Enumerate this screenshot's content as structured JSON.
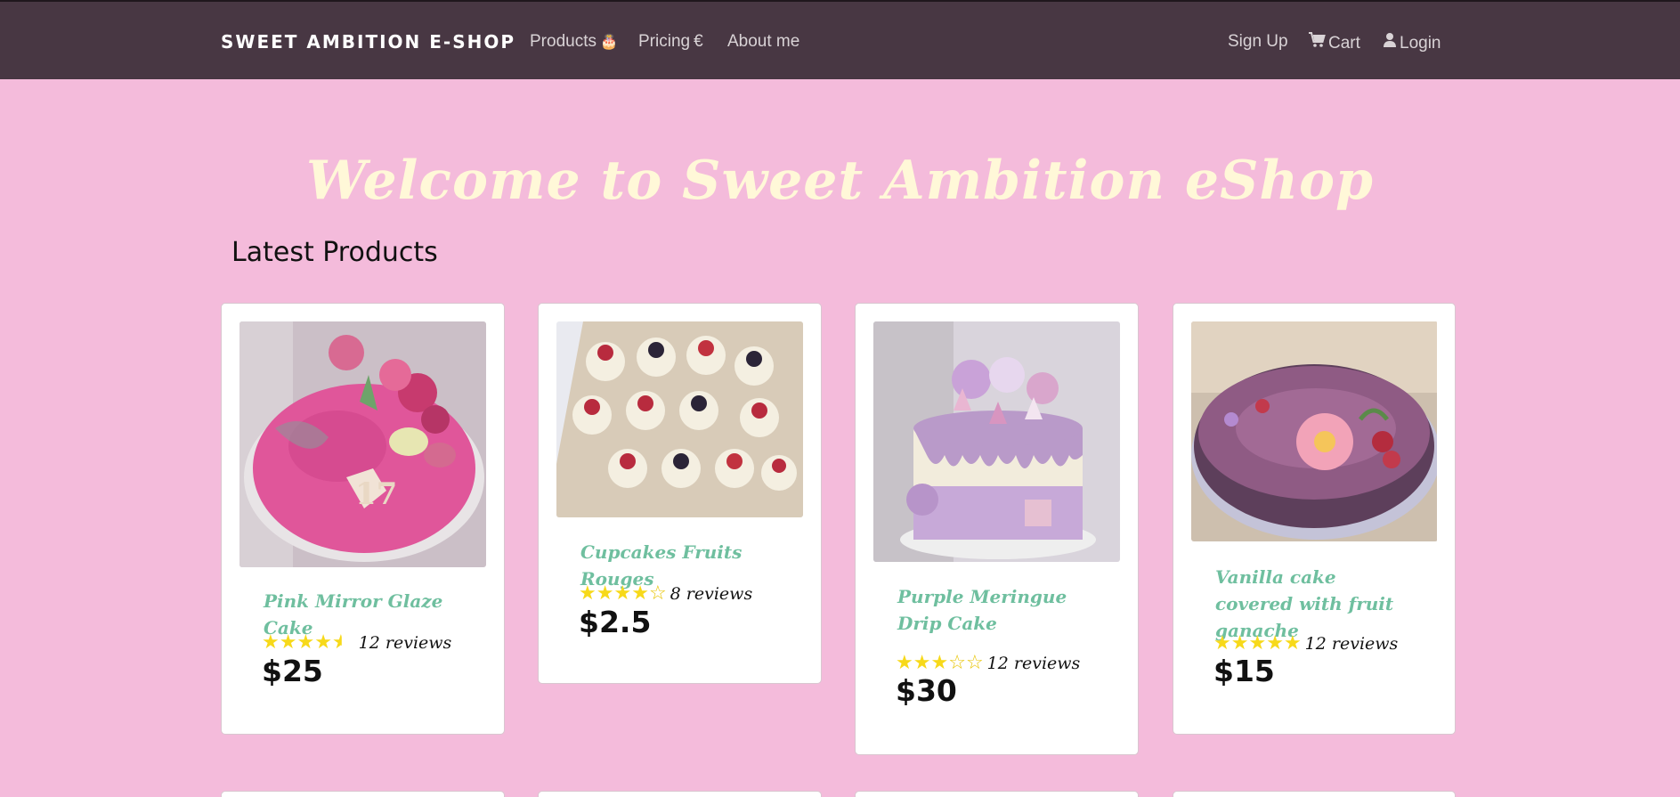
{
  "nav": {
    "brand": "SWEET AMBITION E-SHOP",
    "links": [
      {
        "label": "Products",
        "icon": "birthday-cake-icon",
        "glyph": "🎂"
      },
      {
        "label": "Pricing",
        "icon": "euro-icon",
        "glyph": "€"
      },
      {
        "label": "About me",
        "icon": "",
        "glyph": ""
      }
    ],
    "right_links": [
      {
        "label": "Sign Up",
        "icon": "",
        "glyph": ""
      },
      {
        "label": "Cart",
        "icon": "shopping-cart-icon",
        "glyph": "🛒"
      },
      {
        "label": "Login",
        "icon": "user-icon",
        "glyph": "👤"
      }
    ]
  },
  "hero": {
    "title": "Welcome to Sweet Ambition eShop"
  },
  "section": {
    "title": "Latest Products"
  },
  "products": [
    {
      "title": "Pink Mirror Glaze Cake",
      "rating": 4.5,
      "reviews": "12 reviews",
      "price": "$25",
      "image_theme": "pink-glaze-cake"
    },
    {
      "title": "Cupcakes Fruits Rouges",
      "rating": 4,
      "reviews": "8 reviews",
      "price": "$2.5",
      "image_theme": "cupcakes"
    },
    {
      "title": "Purple Meringue Drip Cake",
      "rating": 3,
      "reviews": "12 reviews",
      "price": "$30",
      "image_theme": "purple-meringue-cake"
    },
    {
      "title": "Vanilla cake covered with fruit ganache",
      "rating": 5,
      "reviews": "12 reviews",
      "price": "$15",
      "image_theme": "vanilla-ganache-cake"
    }
  ],
  "colors": {
    "navbar": "#483743",
    "background": "#f4bbdb",
    "hero_text": "#fff8d8",
    "title_text": "#6fbf9f",
    "star": "#f7d91a"
  }
}
